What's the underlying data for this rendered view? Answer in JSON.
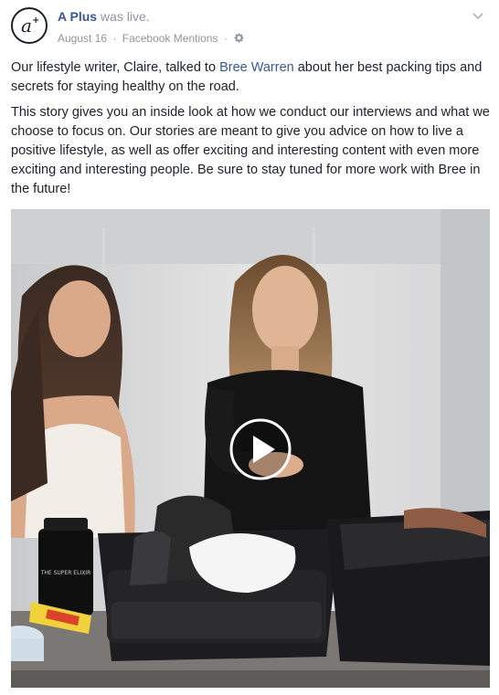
{
  "post": {
    "page_name": "A Plus",
    "action": " was live.",
    "date": "August 16",
    "separator": "·",
    "source": "Facebook Mentions",
    "privacy_icon": "gear-icon",
    "menu_icon": "chevron-down-icon",
    "avatar_icon": "a-plus-logo",
    "paragraph1": {
      "before": "Our lifestyle writer, Claire, talked to ",
      "link": "Bree Warren",
      "after": " about her best packing tips and secrets for staying healthy on the road."
    },
    "paragraph2": "This story gives you an inside look at how we conduct our interviews and what we choose to focus on. Our stories are meant to give you advice on how to live a positive lifestyle, as well as offer exciting and interesting content with even more exciting and interesting people. Be sure to stay tuned for more work with Bree in the future!",
    "video": {
      "play_icon": "play-icon",
      "product_label": "THE SUPER ELIXIR"
    },
    "colors": {
      "link": "#365899",
      "meta": "#90949c",
      "text": "#1d2129"
    }
  }
}
